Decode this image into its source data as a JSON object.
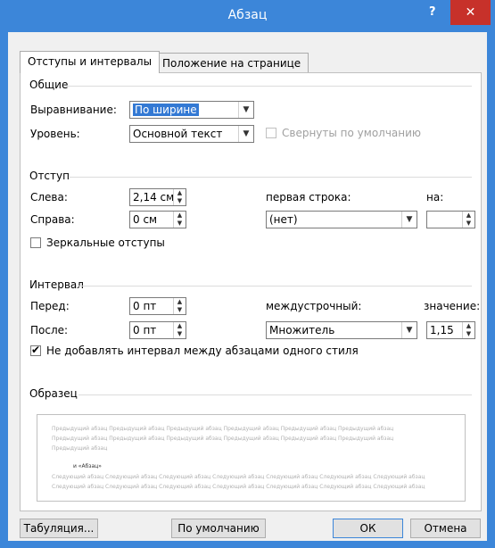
{
  "window": {
    "title": "Абзац",
    "help": "?",
    "close": "✕"
  },
  "tabs": [
    {
      "label": "Отступы и интервалы"
    },
    {
      "label": "Положение на странице"
    }
  ],
  "general": {
    "heading": "Общие",
    "alignment_label": "Выравнивание:",
    "alignment_value": "По ширине",
    "level_label": "Уровень:",
    "level_value": "Основной текст",
    "collapsed_label": "Свернуты по умолчанию"
  },
  "indent": {
    "heading": "Отступ",
    "left_label": "Слева:",
    "left_value": "2,14 см",
    "right_label": "Справа:",
    "right_value": "0 см",
    "first_line_label": "первая строка:",
    "first_line_value": "(нет)",
    "on_label": "на:",
    "on_value": "",
    "mirror_label": "Зеркальные отступы"
  },
  "spacing": {
    "heading": "Интервал",
    "before_label": "Перед:",
    "before_value": "0 пт",
    "after_label": "После:",
    "after_value": "0 пт",
    "line_label": "междустрочный:",
    "line_value": "Множитель",
    "value_label": "значение:",
    "value_value": "1,15",
    "no_space_label": "Не добавлять интервал между абзацами одного стиля"
  },
  "preview": {
    "heading": "Образец",
    "prev1": "Предыдущий абзац Предыдущий абзац Предыдущий абзац Предыдущий абзац Предыдущий абзац Предыдущий абзац",
    "prev2": "Предыдущий абзац Предыдущий абзац Предыдущий абзац Предыдущий абзац Предыдущий абзац Предыдущий абзац",
    "prev3": "Предыдущий абзац",
    "current": "и «Абзац»",
    "next1": "Следующий абзац Следующий абзац Следующий абзац Следующий абзац Следующий абзац Следующий абзац Следующий абзац",
    "next2": "Следующий абзац Следующий абзац Следующий абзац Следующий абзац Следующий абзац Следующий абзац Следующий абзац"
  },
  "buttons": {
    "tabs": "Табуляция...",
    "default": "По умолчанию",
    "ok": "ОК",
    "cancel": "Отмена"
  },
  "colors": {
    "titlebar": "#3c86d9",
    "close": "#c7312a",
    "selection": "#3379d4"
  }
}
